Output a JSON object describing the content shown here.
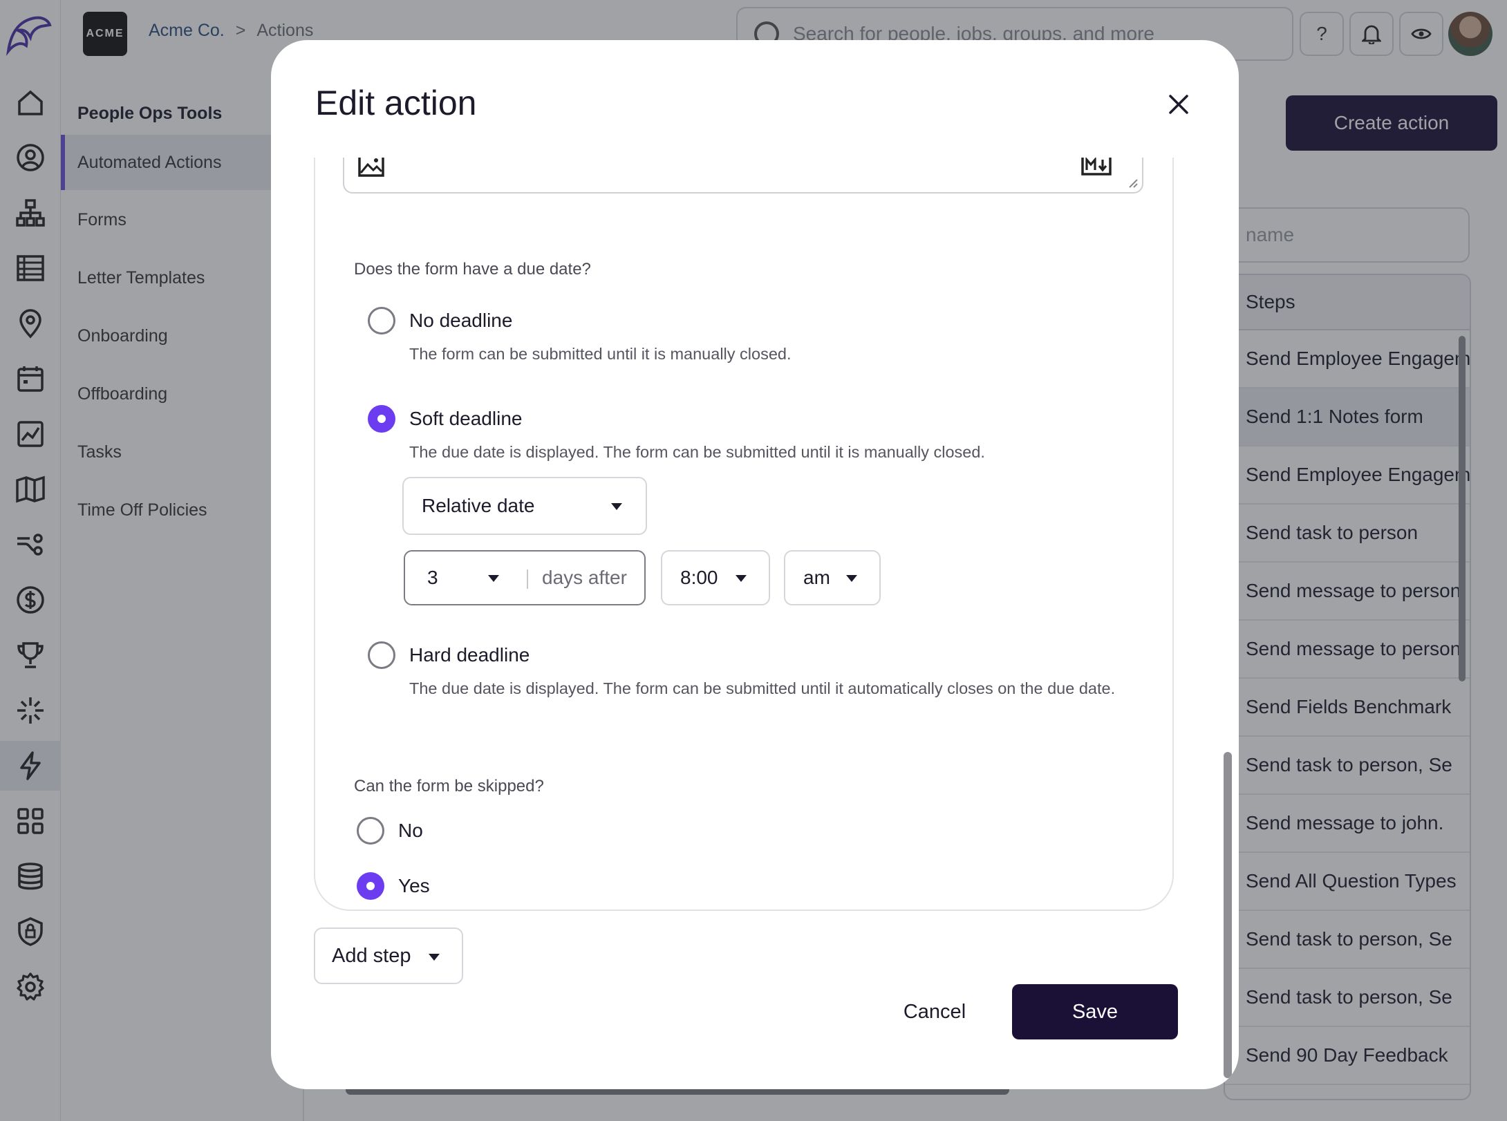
{
  "brand": {
    "logo_text": "ACME"
  },
  "breadcrumb": {
    "org": "Acme Co.",
    "separator": ">",
    "page": "Actions"
  },
  "search": {
    "placeholder": "Search for people, jobs, groups, and more"
  },
  "topbar": {
    "help_label": "?"
  },
  "subnav": {
    "heading": "People Ops Tools",
    "items": [
      "Automated Actions",
      "Forms",
      "Letter Templates",
      "Onboarding",
      "Offboarding",
      "Tasks",
      "Time Off Policies"
    ]
  },
  "page": {
    "create_button": "Create action",
    "name_placeholder": "name",
    "steps_header": "Steps",
    "steps": [
      "Send Employee Engagement",
      "Send 1:1 Notes form",
      "Send Employee Engagement",
      "Send task to person",
      "Send message to person",
      "Send message to person",
      "Send Fields Benchmark",
      "Send task to person, Se",
      "Send message to john.",
      "Send All Question Types",
      "Send task to person, Se",
      "Send task to person, Se",
      "Send 90 Day Feedback"
    ]
  },
  "modal": {
    "title": "Edit action",
    "due_question": "Does the form have a due date?",
    "options": [
      {
        "label": "No deadline",
        "desc": "The form can be submitted until it is manually closed.",
        "selected": false
      },
      {
        "label": "Soft deadline",
        "desc": "The due date is displayed. The form can be submitted until it is manually closed.",
        "selected": true
      },
      {
        "label": "Hard deadline",
        "desc": "The due date is displayed. The form can be submitted until it automatically closes on the due date.",
        "selected": false
      }
    ],
    "date_type": "Relative date",
    "days_value": "3",
    "days_unit": "days after",
    "time_value": "8:00",
    "ampm_value": "am",
    "skip_question": "Can the form be skipped?",
    "skip_options": [
      {
        "label": "No",
        "selected": false
      },
      {
        "label": "Yes",
        "selected": true
      }
    ],
    "add_step": "Add step",
    "cancel": "Cancel",
    "save": "Save"
  },
  "colors": {
    "accent": "#6b3cf0",
    "primary_button": "#1b1036",
    "link": "#2b4b7e"
  }
}
